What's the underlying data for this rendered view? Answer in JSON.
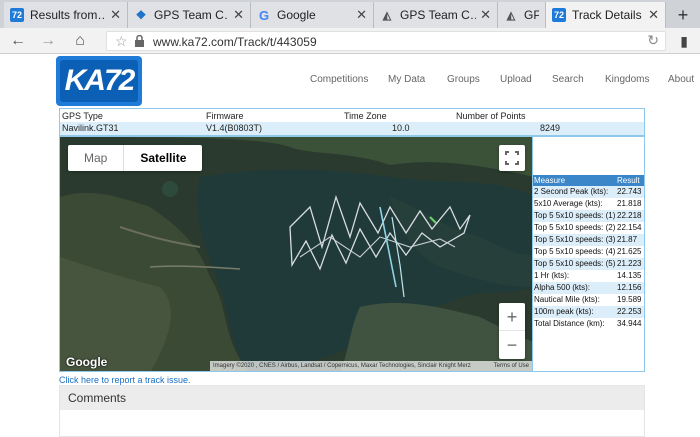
{
  "tabs": [
    {
      "title": "Results from…",
      "icon": "k72-icon"
    },
    {
      "title": "GPS Team C…",
      "icon": "gps-icon"
    },
    {
      "title": "Google",
      "icon": "google-icon"
    },
    {
      "title": "GPS Team C…",
      "icon": "windsurf-icon"
    },
    {
      "title": "GPS",
      "icon": "windsurf-icon"
    },
    {
      "title": "Track Details",
      "icon": "k72-icon",
      "active": true
    }
  ],
  "address_bar": {
    "url": "www.ka72.com/Track/t/443059"
  },
  "logo": {
    "text": "KA72"
  },
  "nav": [
    "Competitions",
    "My Data",
    "Groups",
    "Upload",
    "Search",
    "Kingdoms",
    "About"
  ],
  "track_info": {
    "headers": [
      "GPS Type",
      "Firmware",
      "Time Zone",
      "Number of Points"
    ],
    "values": [
      "Navilink.GT31",
      "V1.4(B0803T)",
      "10.0",
      "8249"
    ]
  },
  "map": {
    "toggle": {
      "map": "Map",
      "satellite": "Satellite",
      "selected": "Satellite"
    },
    "google": "Google",
    "attribution": "Imagery ©2020 , CNES / Airbus, Landsat / Copernicus, Maxar Technologies, Sinclair Knight Merz",
    "terms": "Terms of Use",
    "zoom_in": "+",
    "zoom_out": "−"
  },
  "results": {
    "headers": [
      "Measure",
      "Result"
    ],
    "rows": [
      [
        "2 Second Peak (kts):",
        "22.743"
      ],
      [
        "5x10 Average (kts):",
        "21.818"
      ],
      [
        "Top 5 5x10 speeds: (1)",
        "22.218"
      ],
      [
        "Top 5 5x10 speeds: (2)",
        "22.154"
      ],
      [
        "Top 5 5x10 speeds: (3)",
        "21.87"
      ],
      [
        "Top 5 5x10 speeds: (4)",
        "21.625"
      ],
      [
        "Top 5 5x10 speeds: (5)",
        "21.223"
      ],
      [
        "1 Hr (kts):",
        "14.135"
      ],
      [
        "Alpha 500 (kts):",
        "12.156"
      ],
      [
        "Nautical Mile (kts):",
        "19.589"
      ],
      [
        "100m peak (kts):",
        "22.253"
      ],
      [
        "Total Distance (km):",
        "34.944"
      ]
    ]
  },
  "report_link": "Click here to report a track issue.",
  "comments": {
    "title": "Comments"
  },
  "colors": {
    "accent": "#1f7bd8",
    "result_header": "#3a86c8",
    "row_alt": "#dbeef9",
    "border": "#8ec8ea"
  }
}
